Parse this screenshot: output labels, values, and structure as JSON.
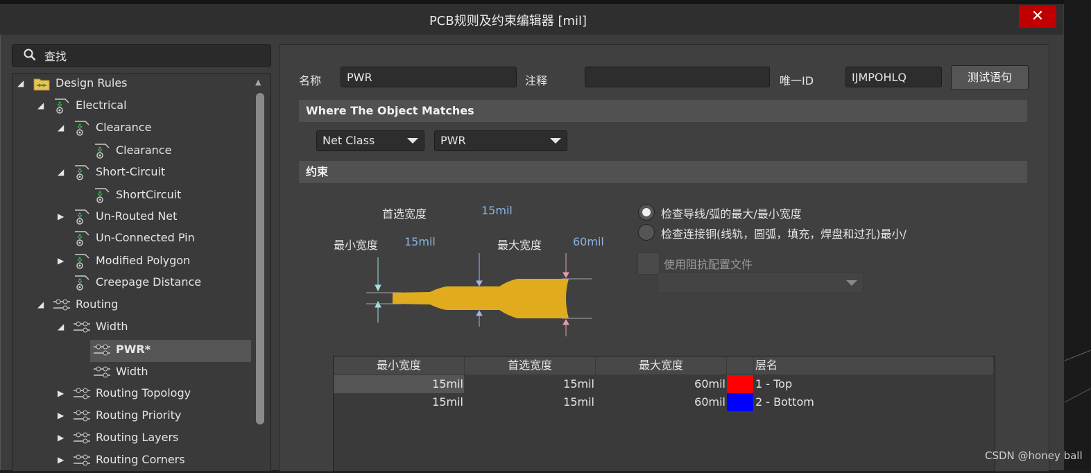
{
  "window": {
    "title": "PCB规则及约束编辑器 [mil]",
    "close_glyph": "✕"
  },
  "search": {
    "placeholder": "查找"
  },
  "tree": [
    {
      "label": "Design Rules",
      "arrow": "◢",
      "icon": "design-rules-folder-icon",
      "selected": false
    },
    {
      "label": "Electrical",
      "arrow": "◢",
      "icon": "electrical-rule-icon",
      "selected": false
    },
    {
      "label": "Clearance",
      "arrow": "◢",
      "icon": "clearance-rule-icon",
      "selected": false
    },
    {
      "label": "Clearance",
      "arrow": "",
      "icon": "clearance-rule-icon",
      "selected": false
    },
    {
      "label": "Short-Circuit",
      "arrow": "◢",
      "icon": "short-circuit-rule-icon",
      "selected": false
    },
    {
      "label": "ShortCircuit",
      "arrow": "",
      "icon": "short-circuit-rule-icon",
      "selected": false
    },
    {
      "label": "Un-Routed Net",
      "arrow": "▶",
      "icon": "unrouted-net-rule-icon",
      "selected": false
    },
    {
      "label": "Un-Connected Pin",
      "arrow": "",
      "icon": "unconnected-pin-rule-icon",
      "selected": false
    },
    {
      "label": "Modified Polygon",
      "arrow": "▶",
      "icon": "modified-polygon-rule-icon",
      "selected": false
    },
    {
      "label": "Creepage Distance",
      "arrow": "",
      "icon": "creepage-rule-icon",
      "selected": false
    },
    {
      "label": "Routing",
      "arrow": "◢",
      "icon": "routing-rule-icon",
      "selected": false
    },
    {
      "label": "Width",
      "arrow": "◢",
      "icon": "width-rule-icon",
      "selected": false
    },
    {
      "label": "PWR*",
      "arrow": "",
      "icon": "width-rule-icon",
      "selected": true
    },
    {
      "label": "Width",
      "arrow": "",
      "icon": "width-rule-icon",
      "selected": false
    },
    {
      "label": "Routing Topology",
      "arrow": "▶",
      "icon": "routing-topology-icon",
      "selected": false
    },
    {
      "label": "Routing Priority",
      "arrow": "▶",
      "icon": "routing-priority-icon",
      "selected": false
    },
    {
      "label": "Routing Layers",
      "arrow": "▶",
      "icon": "routing-layers-icon",
      "selected": false
    },
    {
      "label": "Routing Corners",
      "arrow": "▶",
      "icon": "routing-corners-icon",
      "selected": false
    }
  ],
  "form": {
    "name_label": "名称",
    "name_value": "PWR",
    "comment_label": "注释",
    "comment_value": "",
    "uid_label": "唯一ID",
    "uid_value": "IJMPOHLQ",
    "test_button": "测试语句"
  },
  "match": {
    "section_title": "Where The Object Matches",
    "type": "Net Class",
    "value": "PWR"
  },
  "constraints": {
    "section_title": "约束",
    "preferred_label": "首选宽度",
    "preferred_value": "15mil",
    "min_label": "最小宽度",
    "min_value": "15mil",
    "max_label": "最大宽度",
    "max_value": "60mil",
    "radio1": "检查导线/弧的最大/最小宽度",
    "radio2": "检查连接铜(线轨，圆弧，填充，焊盘和过孔)最小/",
    "impedance_label": "使用阻抗配置文件",
    "trace_color": "#e0ac1e"
  },
  "table": {
    "headers": [
      "最小宽度",
      "首选宽度",
      "最大宽度",
      "",
      "层名"
    ],
    "rows": [
      {
        "min": "15mil",
        "pref": "15mil",
        "max": "60mil",
        "color": "#ff0000",
        "layer": "1 - Top"
      },
      {
        "min": "15mil",
        "pref": "15mil",
        "max": "60mil",
        "color": "#0000ff",
        "layer": "2 - Bottom"
      }
    ]
  },
  "watermark": "CSDN @honey ball"
}
